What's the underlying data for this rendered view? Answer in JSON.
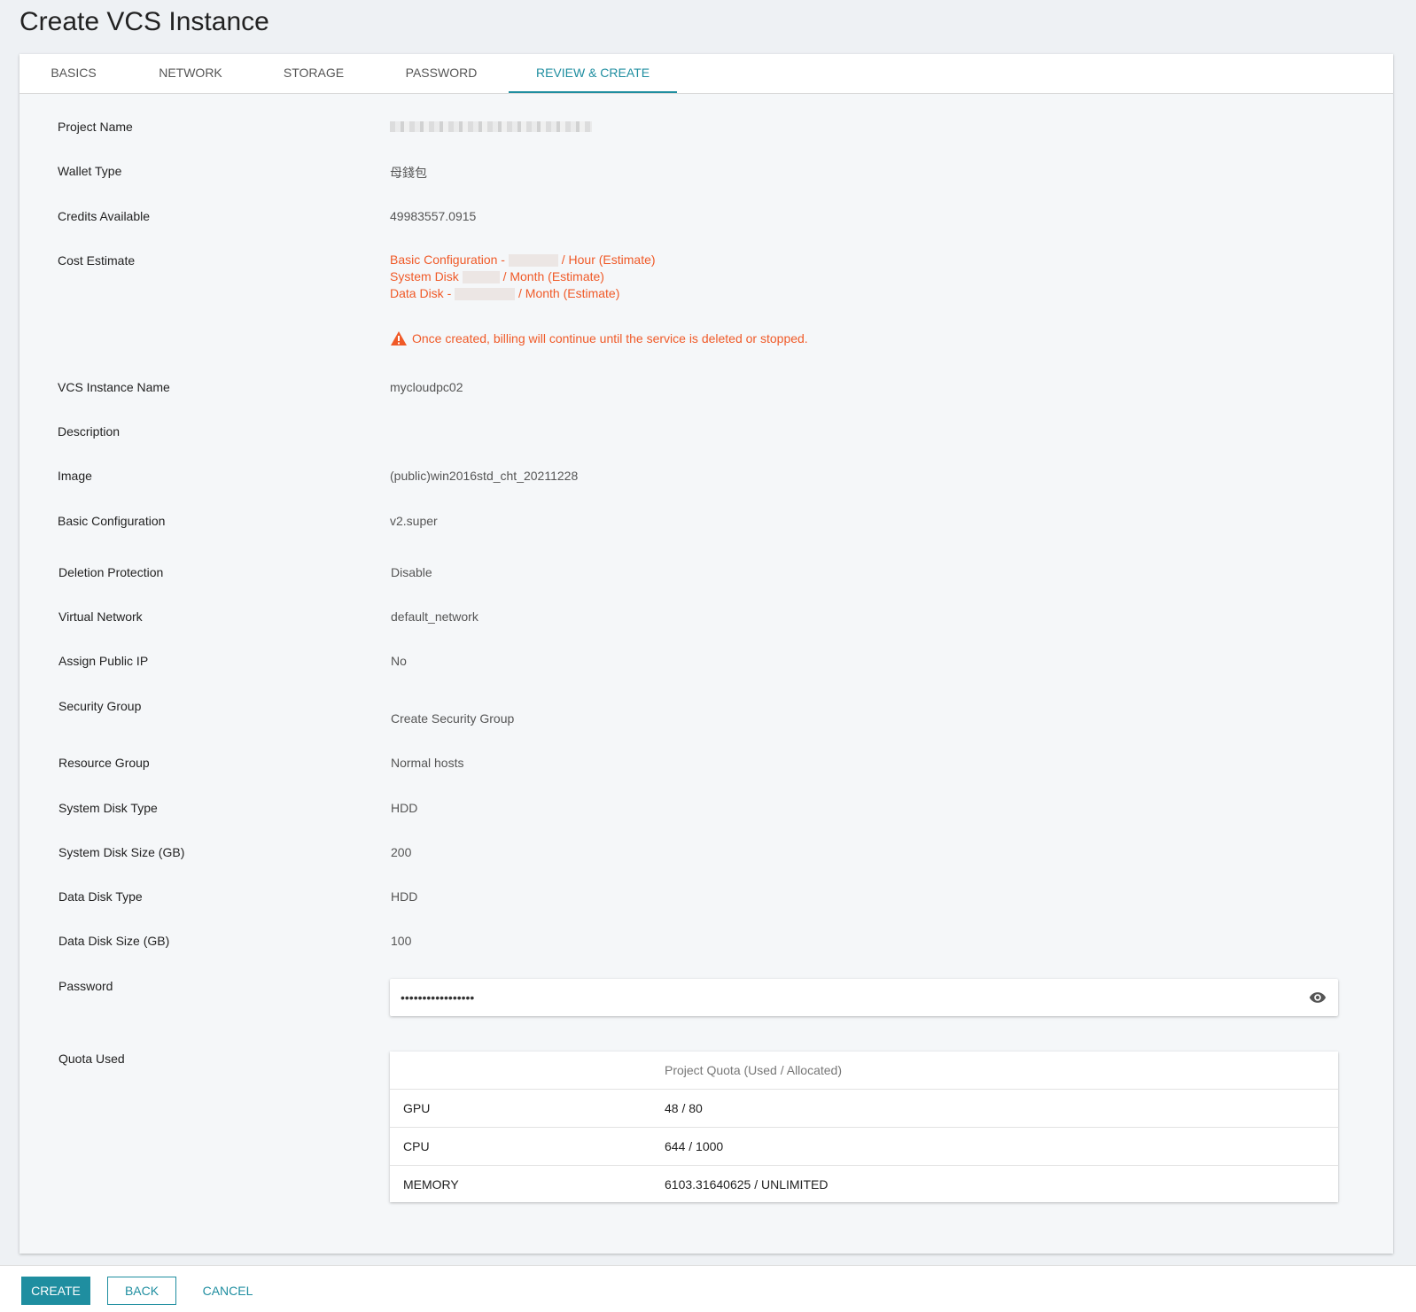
{
  "page": {
    "title": "Create VCS Instance"
  },
  "tabs": [
    {
      "label": "BASICS"
    },
    {
      "label": "NETWORK"
    },
    {
      "label": "STORAGE"
    },
    {
      "label": "PASSWORD"
    },
    {
      "label": "REVIEW & CREATE",
      "active": true
    }
  ],
  "review": {
    "project_name": {
      "label": "Project Name"
    },
    "wallet_type": {
      "label": "Wallet Type",
      "value": "母錢包"
    },
    "credits_available": {
      "label": "Credits Available",
      "value": "49983557.0915"
    },
    "cost_estimate": {
      "label": "Cost Estimate",
      "basic_prefix": "Basic Configuration -",
      "basic_suffix": "/ Hour (Estimate)",
      "system_prefix": "System Disk",
      "system_suffix": "/ Month (Estimate)",
      "data_prefix": "Data Disk -",
      "data_suffix": "/ Month (Estimate)",
      "warning": "Once created, billing will continue until the service is deleted or stopped."
    },
    "vcs_instance_name": {
      "label": "VCS Instance Name",
      "value": "mycloudpc02"
    },
    "description": {
      "label": "Description",
      "value": ""
    },
    "image": {
      "label": "Image",
      "value": "(public)win2016std_cht_20211228"
    },
    "basic_configuration": {
      "label": "Basic Configuration",
      "value": "v2.super"
    },
    "deletion_protection": {
      "label": "Deletion Protection",
      "value": "Disable"
    },
    "virtual_network": {
      "label": "Virtual Network",
      "value": "default_network"
    },
    "assign_public_ip": {
      "label": "Assign Public IP",
      "value": "No"
    },
    "security_group": {
      "label": "Security Group",
      "value": "Create Security Group"
    },
    "resource_group": {
      "label": "Resource Group",
      "value": "Normal hosts"
    },
    "system_disk_type": {
      "label": "System Disk Type",
      "value": "HDD"
    },
    "system_disk_size": {
      "label": "System Disk Size (GB)",
      "value": "200"
    },
    "data_disk_type": {
      "label": "Data Disk Type",
      "value": "HDD"
    },
    "data_disk_size": {
      "label": "Data Disk Size (GB)",
      "value": "100"
    },
    "password": {
      "label": "Password",
      "value": "•••••••••••••••••"
    },
    "quota_used": {
      "label": "Quota Used",
      "column_header": "Project Quota (Used / Allocated)",
      "rows": [
        {
          "name": "GPU",
          "value": "48 / 80"
        },
        {
          "name": "CPU",
          "value": "644 / 1000"
        },
        {
          "name": "MEMORY",
          "value": "6103.31640625 / UNLIMITED"
        }
      ]
    }
  },
  "footer": {
    "create_label": "CREATE",
    "back_label": "BACK",
    "cancel_label": "CANCEL"
  },
  "colors": {
    "accent": "#1f8ea0",
    "warning": "#f05a28"
  }
}
